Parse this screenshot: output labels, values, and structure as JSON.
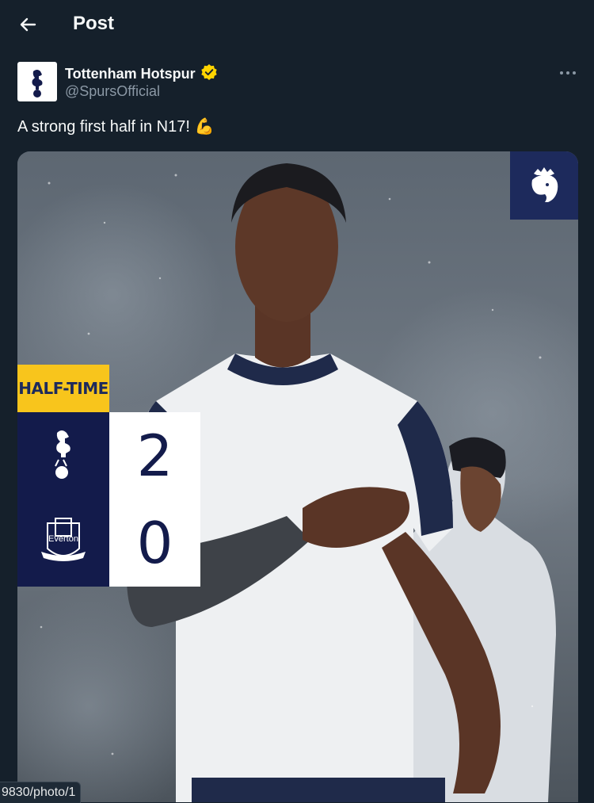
{
  "header": {
    "title": "Post",
    "back_icon": "arrow-left-icon"
  },
  "author": {
    "name": "Tottenham Hotspur",
    "handle": "@SpursOfficial",
    "verified_badge_color": "#ffd400",
    "avatar_icon": "cockerel-crest-icon"
  },
  "more_icon": "more-horizontal-icon",
  "tweet": {
    "text": "A strong first half in N17! 💪"
  },
  "media": {
    "competition_icon": "premier-league-lion-icon",
    "status_label": "HALF-TIME",
    "home": {
      "crest": "tottenham-crest-icon",
      "score": "2"
    },
    "away": {
      "crest": "everton-crest-icon",
      "crest_text": "Everton",
      "score": "0"
    },
    "colors": {
      "navy": "#131b4b",
      "yellow": "#f8c51c",
      "score_bg": "#ffffff"
    }
  },
  "status_bar": {
    "url": "9830/photo/1"
  }
}
